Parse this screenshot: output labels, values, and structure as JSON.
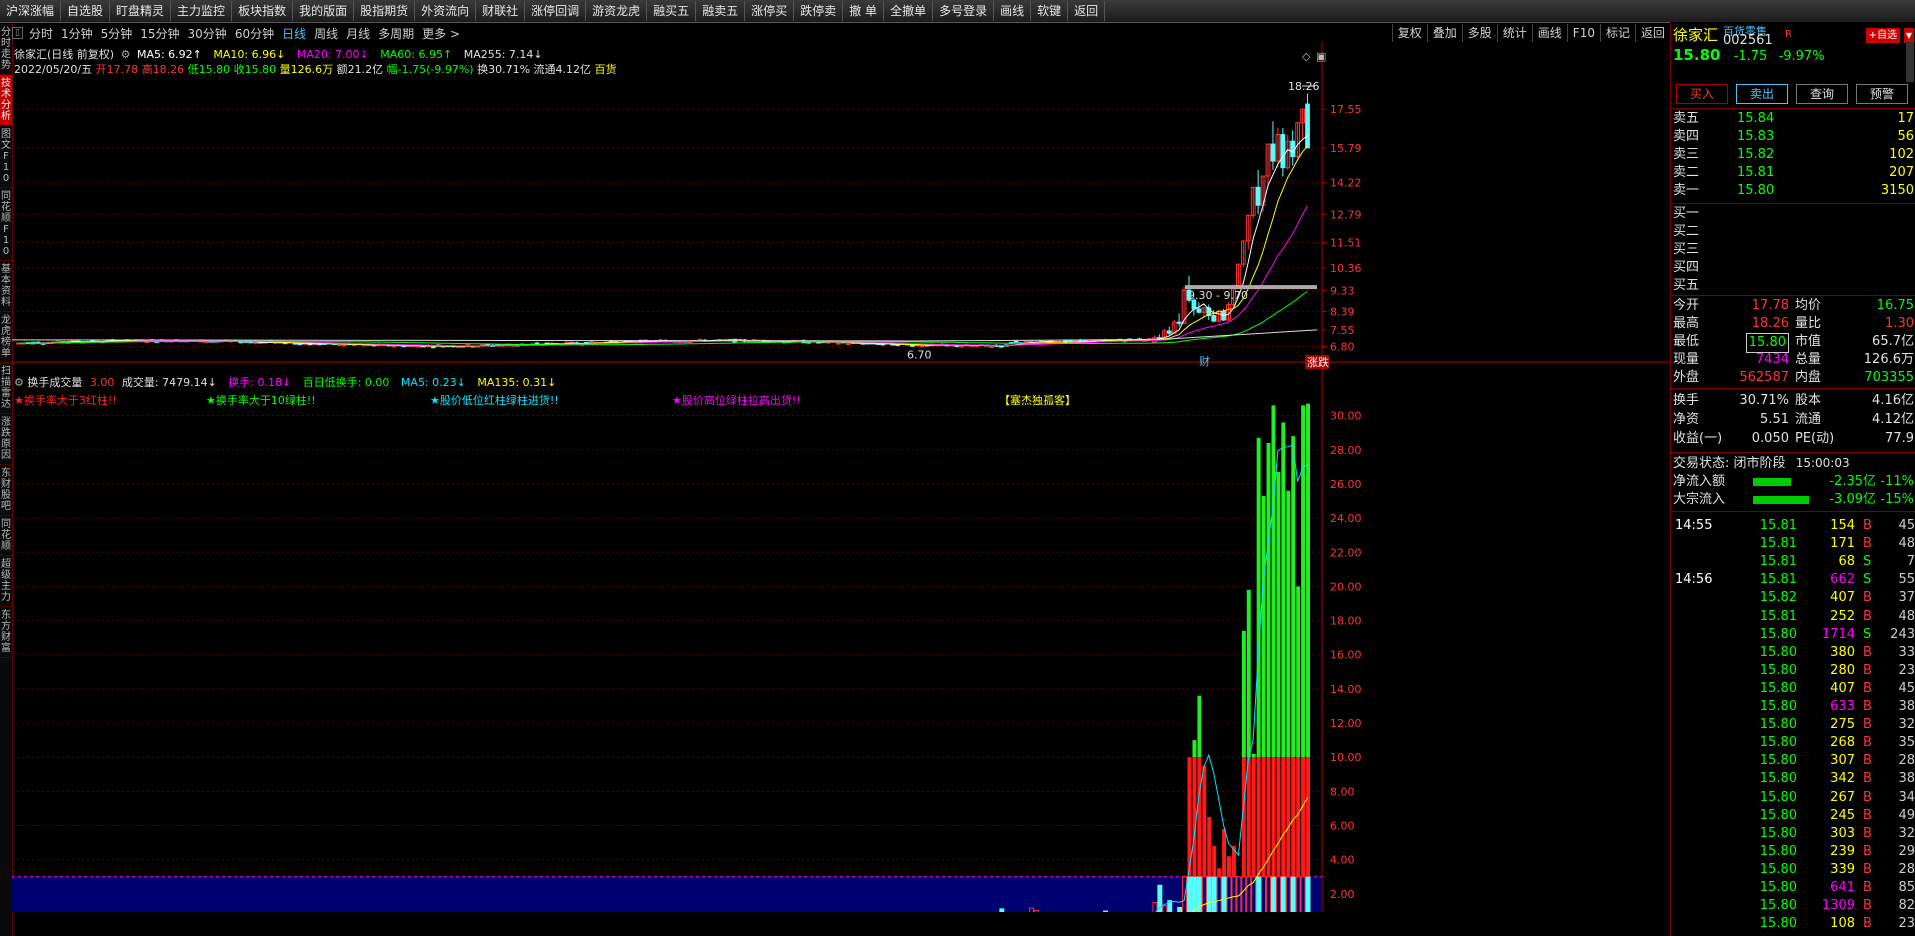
{
  "topbar": [
    "沪深涨幅",
    "自选股",
    "盯盘精灵",
    "主力监控",
    "板块指数",
    "我的版面",
    "股指期货",
    "外资流向",
    "财联社",
    "涨停回调",
    "游资龙虎",
    "融买五",
    "融卖五",
    "涨停买",
    "跌停卖",
    "撤 单",
    "全撤单",
    "多号登录",
    "画线",
    "软键",
    "返回"
  ],
  "periods": [
    "分时",
    "1分钟",
    "5分钟",
    "15分钟",
    "30分钟",
    "60分钟",
    "日线",
    "周线",
    "月线",
    "多周期",
    "更多 >"
  ],
  "active_period": "日线",
  "right_tools": [
    "复权",
    "叠加",
    "多股",
    "统计",
    "画线",
    "F10",
    "标记",
    "返回"
  ],
  "left_tabs": [
    "分时走势",
    "技术分析",
    "图文F10",
    "同花顺F10",
    "基本资料",
    "龙虎榜单",
    "扫描雷达",
    "涨跌原因",
    "东财股吧",
    "同花顺",
    "超级主力",
    "东方财富"
  ],
  "active_left_tab": "技术分析",
  "main_info": {
    "name": "徐家汇(日线 前复权)",
    "ma5": "MA5: 6.92↑",
    "ma10": "MA10: 6.96↓",
    "ma20": "MA20: 7.00↓",
    "ma60": "MA60: 6.95↑",
    "ma255": "MA255: 7.14↓"
  },
  "ohlc": {
    "date": "2022/05/20/五",
    "open": "开17.78",
    "high": "高18.26",
    "low": "低15.80",
    "close": "收15.80",
    "vol": "量126.6万",
    "amt": "额21.2亿",
    "chg": "幅-1.75(-9.97%)",
    "turn": "换30.71%",
    "float": "流通4.12亿",
    "sector": "百货"
  },
  "price_axis": [
    "17.55",
    "15.79",
    "14.22",
    "12.79",
    "11.51",
    "10.36",
    "9.33",
    "8.39",
    "7.55",
    "6.80"
  ],
  "price_annot": {
    "high": "18.26",
    "low": "6.70",
    "range": "9.30 - 9.70",
    "cai": "财",
    "zhangdie": "涨跌"
  },
  "vol_info": {
    "title": "换手成交量",
    "v1": "3.00",
    "cjl": "成交量: 7479.14↓",
    "hs": "换手: 0.18↓",
    "bai": "百日低换手: 0.00",
    "ma5": "MA5: 0.23↓",
    "ma135": "MA135: 0.31↓"
  },
  "signals": [
    "★换手率大于3红柱!!",
    "★换手率大于10绿柱!!",
    "★股价低位红柱绿柱进货!!",
    "★股价高位绿柱拉高出货!!",
    "【塞杰独孤客】"
  ],
  "vol_axis": [
    "30.00",
    "28.00",
    "26.00",
    "24.00",
    "22.00",
    "20.00",
    "18.00",
    "16.00",
    "14.00",
    "12.00",
    "10.00",
    "8.00",
    "6.00",
    "4.00",
    "2.00"
  ],
  "chart_data": {
    "type": "candlestick",
    "price_bars_recent": [
      {
        "o": 7.0,
        "h": 7.3,
        "l": 6.95,
        "c": 7.2
      },
      {
        "o": 7.2,
        "h": 7.35,
        "l": 7.05,
        "c": 7.1
      },
      {
        "o": 7.1,
        "h": 7.6,
        "l": 7.05,
        "c": 7.5
      },
      {
        "o": 7.5,
        "h": 7.7,
        "l": 7.3,
        "c": 7.4
      },
      {
        "o": 7.4,
        "h": 8.0,
        "l": 7.35,
        "c": 7.9
      },
      {
        "o": 7.9,
        "h": 8.3,
        "l": 7.7,
        "c": 7.85
      },
      {
        "o": 7.85,
        "h": 9.5,
        "l": 7.8,
        "c": 9.35
      },
      {
        "o": 9.35,
        "h": 10.0,
        "l": 8.8,
        "c": 8.9
      },
      {
        "o": 8.9,
        "h": 9.0,
        "l": 8.2,
        "c": 8.5
      },
      {
        "o": 8.5,
        "h": 8.8,
        "l": 8.3,
        "c": 8.35
      },
      {
        "o": 8.35,
        "h": 8.6,
        "l": 8.1,
        "c": 8.55
      },
      {
        "o": 8.55,
        "h": 8.7,
        "l": 8.0,
        "c": 8.2
      },
      {
        "o": 8.2,
        "h": 8.45,
        "l": 7.9,
        "c": 7.95
      },
      {
        "o": 7.95,
        "h": 8.45,
        "l": 7.9,
        "c": 8.4
      },
      {
        "o": 8.4,
        "h": 8.5,
        "l": 7.95,
        "c": 8.0
      },
      {
        "o": 8.0,
        "h": 8.8,
        "l": 7.95,
        "c": 8.7
      },
      {
        "o": 8.7,
        "h": 9.57,
        "l": 8.6,
        "c": 9.57
      },
      {
        "o": 9.57,
        "h": 10.53,
        "l": 9.5,
        "c": 10.53
      },
      {
        "o": 10.53,
        "h": 11.58,
        "l": 10.4,
        "c": 11.58
      },
      {
        "o": 11.58,
        "h": 12.74,
        "l": 11.2,
        "c": 12.74
      },
      {
        "o": 12.74,
        "h": 14.01,
        "l": 12.6,
        "c": 14.01
      },
      {
        "o": 14.01,
        "h": 14.8,
        "l": 12.8,
        "c": 13.2
      },
      {
        "o": 13.2,
        "h": 14.52,
        "l": 12.9,
        "c": 14.52
      },
      {
        "o": 14.52,
        "h": 15.97,
        "l": 14.0,
        "c": 15.97
      },
      {
        "o": 15.97,
        "h": 17.0,
        "l": 14.8,
        "c": 15.2
      },
      {
        "o": 15.2,
        "h": 16.72,
        "l": 14.9,
        "c": 16.4
      },
      {
        "o": 16.4,
        "h": 16.7,
        "l": 14.5,
        "c": 14.9
      },
      {
        "o": 14.9,
        "h": 16.39,
        "l": 14.8,
        "c": 16.1
      },
      {
        "o": 16.1,
        "h": 16.6,
        "l": 15.0,
        "c": 15.4
      },
      {
        "o": 15.4,
        "h": 16.94,
        "l": 15.2,
        "c": 16.94
      },
      {
        "o": 16.94,
        "h": 17.55,
        "l": 16.2,
        "c": 17.55
      },
      {
        "o": 17.78,
        "h": 18.26,
        "l": 15.8,
        "c": 15.8
      }
    ],
    "turnover_recent": [
      1.5,
      2.5,
      1.3,
      1.6,
      0.9,
      1.2,
      3.0,
      10.0,
      11.0,
      13.6,
      9.5,
      6.5,
      4.8,
      3.5,
      5.8,
      4.2,
      4.8,
      3.0,
      17.4,
      19.8,
      10.2,
      28.7,
      25.3,
      28.4,
      30.6,
      26.7,
      29.6,
      25.6,
      28.8,
      20.0,
      30.6,
      30.7
    ]
  },
  "quote": {
    "name": "徐家汇",
    "sector": "百货零售",
    "code": "002561",
    "flag": "R",
    "add_btn": "+自选",
    "price": "15.80",
    "chg": "-1.75",
    "pct": "-9.97%",
    "buttons": [
      "买入",
      "卖出",
      "查询",
      "预警"
    ]
  },
  "sells": [
    {
      "label": "卖五",
      "price": "15.84",
      "vol": "17"
    },
    {
      "label": "卖四",
      "price": "15.83",
      "vol": "56"
    },
    {
      "label": "卖三",
      "price": "15.82",
      "vol": "102"
    },
    {
      "label": "卖二",
      "price": "15.81",
      "vol": "207"
    },
    {
      "label": "卖一",
      "price": "15.80",
      "vol": "3150"
    }
  ],
  "buys": [
    "买一",
    "买二",
    "买三",
    "买四",
    "买五"
  ],
  "stats": [
    {
      "l1": "今开",
      "v1": "17.78",
      "c1": "#ff3333",
      "l2": "均价",
      "v2": "16.75",
      "c2": "#00ff00"
    },
    {
      "l1": "最高",
      "v1": "18.26",
      "c1": "#ff3333",
      "l2": "量比",
      "v2": "1.30",
      "c2": "#ff3333"
    },
    {
      "l1": "最低",
      "v1": "15.80",
      "c1": "#00ff00",
      "l2": "市值",
      "v2": "65.7亿",
      "c2": "#e0e0e0"
    },
    {
      "l1": "现量",
      "v1": "7434",
      "c1": "#ff00ff",
      "l2": "总量",
      "v2": "126.6万",
      "c2": "#e0e0e0"
    },
    {
      "l1": "外盘",
      "v1": "562587",
      "c1": "#ff3333",
      "l2": "内盘",
      "v2": "703355",
      "c2": "#00ff00"
    }
  ],
  "stats2": [
    {
      "l1": "换手",
      "v1": "30.71%",
      "l2": "股本",
      "v2": "4.16亿"
    },
    {
      "l1": "净资",
      "v1": "5.51",
      "l2": "流通",
      "v2": "4.12亿"
    },
    {
      "l1": "收益(一)",
      "v1": "0.050",
      "l2": "PE(动)",
      "v2": "77.9"
    }
  ],
  "trade_state": {
    "label": "交易状态:",
    "state": "闭市阶段",
    "time": "15:00:03"
  },
  "flows": [
    {
      "label": "净流入额",
      "amt": "-2.35亿",
      "pct": "-11%"
    },
    {
      "label": "大宗流入",
      "amt": "-3.09亿",
      "pct": "-15%"
    }
  ],
  "ticks": [
    {
      "t": "14:55",
      "p": "15.81",
      "v": "154",
      "s": "B",
      "n": "45"
    },
    {
      "t": "",
      "p": "15.81",
      "v": "171",
      "s": "B",
      "n": "48"
    },
    {
      "t": "",
      "p": "15.81",
      "v": "68",
      "s": "S",
      "n": "7"
    },
    {
      "t": "14:56",
      "p": "15.81",
      "v": "662",
      "s": "S",
      "n": "55"
    },
    {
      "t": "",
      "p": "15.82",
      "v": "407",
      "s": "B",
      "n": "37"
    },
    {
      "t": "",
      "p": "15.81",
      "v": "252",
      "s": "B",
      "n": "48"
    },
    {
      "t": "",
      "p": "15.80",
      "v": "1714",
      "s": "S",
      "n": "243"
    },
    {
      "t": "",
      "p": "15.80",
      "v": "380",
      "s": "B",
      "n": "33"
    },
    {
      "t": "",
      "p": "15.80",
      "v": "280",
      "s": "B",
      "n": "23"
    },
    {
      "t": "",
      "p": "15.80",
      "v": "407",
      "s": "B",
      "n": "45"
    },
    {
      "t": "",
      "p": "15.80",
      "v": "633",
      "s": "B",
      "n": "38"
    },
    {
      "t": "",
      "p": "15.80",
      "v": "275",
      "s": "B",
      "n": "32"
    },
    {
      "t": "",
      "p": "15.80",
      "v": "268",
      "s": "B",
      "n": "35"
    },
    {
      "t": "",
      "p": "15.80",
      "v": "307",
      "s": "B",
      "n": "28"
    },
    {
      "t": "",
      "p": "15.80",
      "v": "342",
      "s": "B",
      "n": "38"
    },
    {
      "t": "",
      "p": "15.80",
      "v": "267",
      "s": "B",
      "n": "34"
    },
    {
      "t": "",
      "p": "15.80",
      "v": "245",
      "s": "B",
      "n": "49"
    },
    {
      "t": "",
      "p": "15.80",
      "v": "303",
      "s": "B",
      "n": "32"
    },
    {
      "t": "",
      "p": "15.80",
      "v": "239",
      "s": "B",
      "n": "29"
    },
    {
      "t": "",
      "p": "15.80",
      "v": "339",
      "s": "B",
      "n": "28"
    },
    {
      "t": "",
      "p": "15.80",
      "v": "641",
      "s": "B",
      "n": "85"
    },
    {
      "t": "",
      "p": "15.80",
      "v": "1309",
      "s": "B",
      "n": "82"
    },
    {
      "t": "",
      "p": "15.80",
      "v": "108",
      "s": "B",
      "n": "23"
    }
  ]
}
